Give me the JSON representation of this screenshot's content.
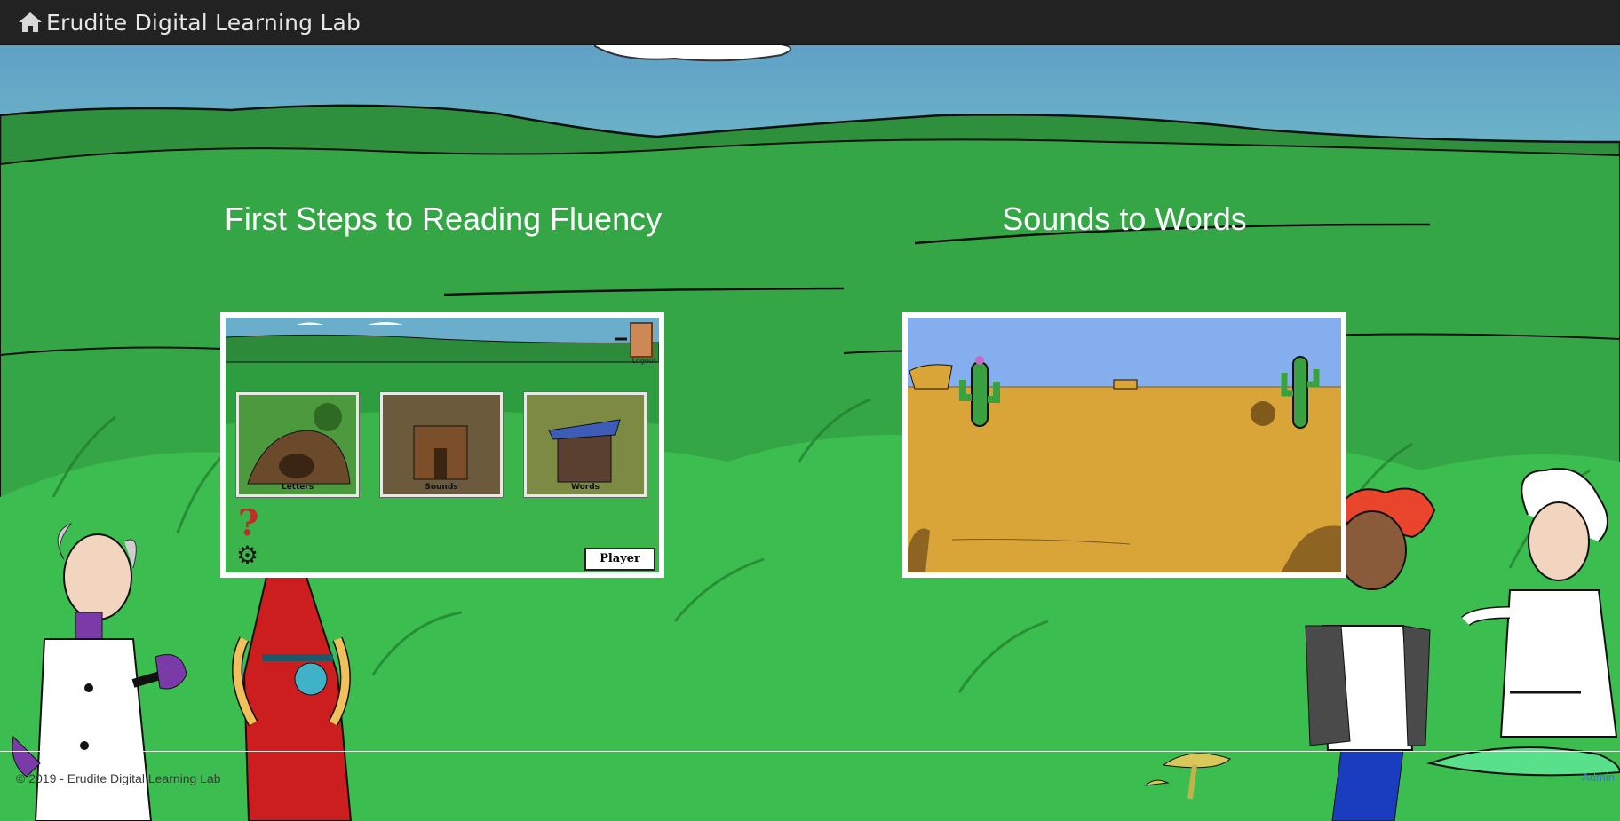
{
  "navbar": {
    "home_icon": "home-icon",
    "brand_name": "Erudite Digital Learning Lab"
  },
  "courses": [
    {
      "title": "First Steps to Reading Fluency",
      "preview": {
        "tiles": [
          "Letters",
          "Sounds",
          "Words"
        ],
        "logout_label": "Logout",
        "player_label": "Player",
        "help_icon": "question-mark-icon",
        "settings_icon": "gear-icon"
      }
    },
    {
      "title": "Sounds to Words",
      "preview": {
        "scene": "desert"
      }
    }
  ],
  "footer": {
    "copyright": "© 2019 - Erudite Digital Learning Lab",
    "right_link": "Admin"
  },
  "colors": {
    "navbar_bg": "#222222",
    "grass": "#37b14a",
    "sky": "#5fa3c8",
    "desert_sand": "#d9a438",
    "desert_sky": "#85aeee"
  }
}
